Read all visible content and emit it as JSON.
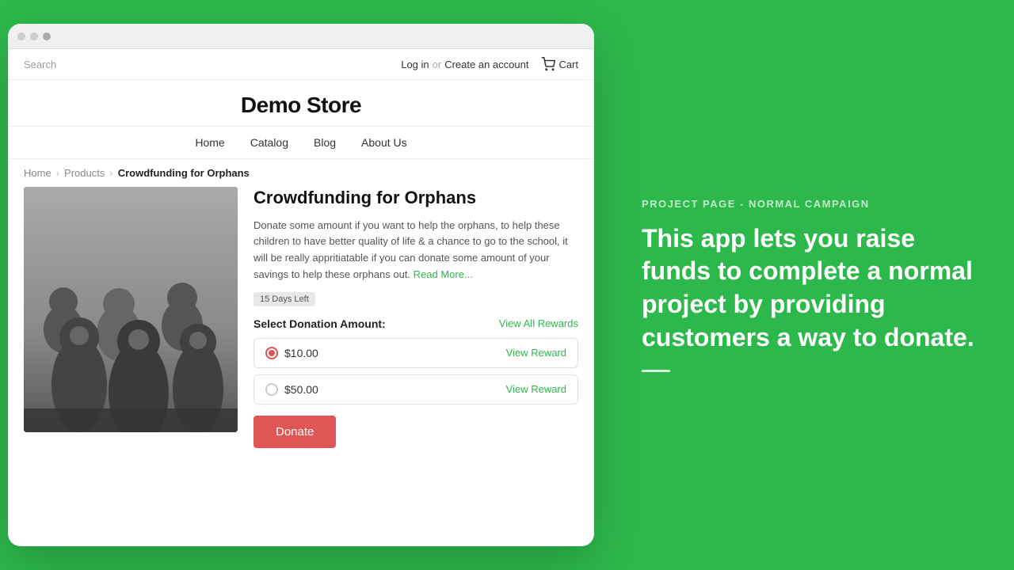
{
  "background_color": "#2db84b",
  "left": {
    "store": {
      "title": "Demo Store",
      "topbar": {
        "search_placeholder": "Search",
        "login_label": "Log in",
        "or_text": "or",
        "create_account_label": "Create an account",
        "cart_label": "Cart"
      },
      "nav": {
        "items": [
          {
            "label": "Home"
          },
          {
            "label": "Catalog"
          },
          {
            "label": "Blog"
          },
          {
            "label": "About Us"
          }
        ]
      },
      "breadcrumb": {
        "home_label": "Home",
        "products_label": "Products",
        "current_label": "Crowdfunding for Orphans"
      },
      "product": {
        "title": "Crowdfunding for Orphans",
        "description": "Donate some amount if you want to help the orphans, to help these children to have better quality of life & a chance to go to the school, it will be really appritiatable if you can donate some amount of your savings to help these orphans out.",
        "read_more_label": "Read More...",
        "days_left_badge": "15 Days Left",
        "donation_section_title": "Select Donation Amount:",
        "view_all_rewards_label": "View All Rewards",
        "options": [
          {
            "amount": "$10.00",
            "selected": true,
            "view_reward_label": "View Reward"
          },
          {
            "amount": "$50.00",
            "selected": false,
            "view_reward_label": "View Reward"
          }
        ],
        "donate_button_label": "Donate"
      }
    }
  },
  "right": {
    "subtitle": "PROJECT PAGE - NORMAL CAMPAIGN",
    "title": "This app lets you raise funds to complete a normal project by providing customers a way to donate."
  }
}
